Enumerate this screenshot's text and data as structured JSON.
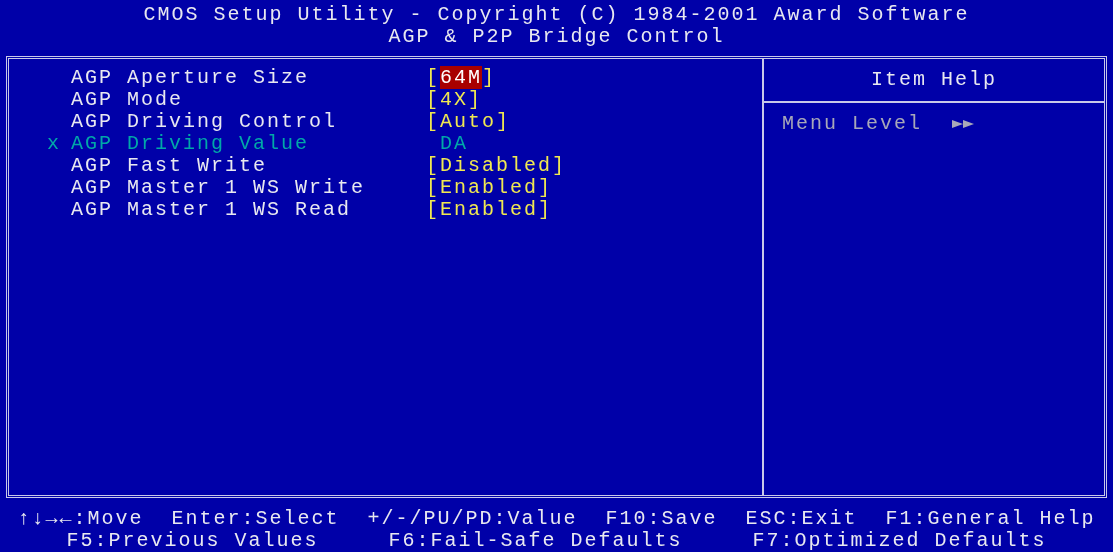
{
  "header": {
    "title": "CMOS Setup Utility - Copyright (C) 1984-2001 Award Software",
    "subtitle": "AGP & P2P Bridge Control"
  },
  "settings": [
    {
      "label": "AGP Aperture Size",
      "open": "[",
      "value": "64M",
      "close": "]",
      "selected": true,
      "disabled": false
    },
    {
      "label": "AGP Mode",
      "open": "[",
      "value": "4X",
      "close": "]",
      "selected": false,
      "disabled": false
    },
    {
      "label": "AGP Driving Control",
      "open": "[",
      "value": "Auto",
      "close": "]",
      "selected": false,
      "disabled": false
    },
    {
      "label": "AGP Driving Value",
      "value": "DA",
      "selected": false,
      "disabled": true,
      "marker": "x"
    },
    {
      "label": "AGP Fast Write",
      "open": "[",
      "value": "Disabled",
      "close": "]",
      "selected": false,
      "disabled": false
    },
    {
      "label": "AGP Master 1 WS Write",
      "open": "[",
      "value": "Enabled",
      "close": "]",
      "selected": false,
      "disabled": false
    },
    {
      "label": "AGP Master 1 WS Read",
      "open": "[",
      "value": "Enabled",
      "close": "]",
      "selected": false,
      "disabled": false
    }
  ],
  "help": {
    "title": "Item Help",
    "menu_level": "Menu Level"
  },
  "footer": [
    "↑↓→←:Move  Enter:Select  +/-/PU/PD:Value  F10:Save  ESC:Exit  F1:General Help",
    "F5:Previous Values     F6:Fail-Safe Defaults     F7:Optimized Defaults"
  ]
}
